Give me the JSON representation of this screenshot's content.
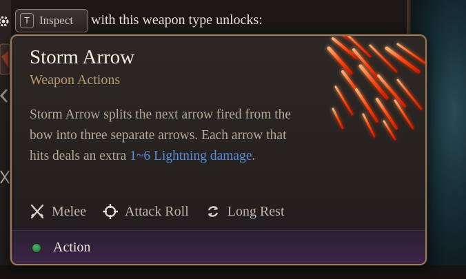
{
  "hint": {
    "key": "T",
    "key_action": "Inspect",
    "text": "with this weapon type unlocks:"
  },
  "tooltip": {
    "title": "Storm Arrow",
    "subtitle": "Weapon Actions",
    "description": {
      "part1": "Storm Arrow splits the next arrow fired from the bow into three separate arrows. Each arrow that hits deals an extra ",
      "highlight": "1~6 Lightning damage",
      "part2": "."
    },
    "tags": [
      {
        "label": "Melee",
        "icon": "crossed-swords-icon"
      },
      {
        "label": "Attack Roll",
        "icon": "crosshair-icon"
      },
      {
        "label": "Long Rest",
        "icon": "rest-cycle-icon"
      }
    ],
    "cost": {
      "label": "Action",
      "icon": "action-dot-icon",
      "color": "#3f9a57"
    }
  },
  "colors": {
    "border": "#9a7a55",
    "title": "#f2ece2",
    "subtitle": "#b89a72",
    "highlight": "#5a8ee0",
    "spell_glow": "#ff5a1a"
  }
}
